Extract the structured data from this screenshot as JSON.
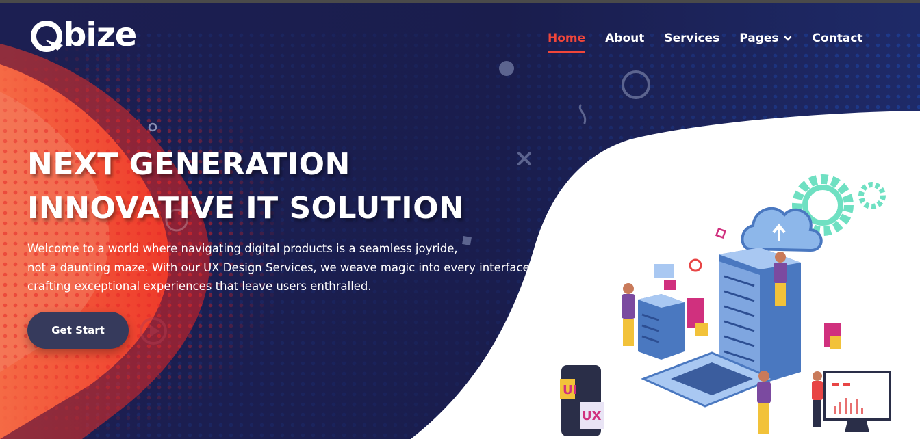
{
  "brand": {
    "name": "bize",
    "accent": "#f0463a",
    "primary": "#1c1f52"
  },
  "nav": {
    "items": [
      {
        "label": "Home",
        "active": true
      },
      {
        "label": "About",
        "active": false
      },
      {
        "label": "Services",
        "active": false
      },
      {
        "label": "Pages",
        "active": false,
        "dropdown": true
      },
      {
        "label": "Contact",
        "active": false
      }
    ]
  },
  "hero": {
    "headline_line1": "NEXT GENERATION",
    "headline_line2": "INNOVATIVE IT SOLUTION",
    "intro_line1": "Welcome to a world where navigating digital products is a seamless joyride,",
    "intro_line2": "not a daunting maze. With our UX Design Services, we weave magic into every interface,",
    "intro_line3": "crafting exceptional experiences that leave users enthralled.",
    "cta_label": "Get Start",
    "play_icon": "play-icon"
  },
  "illustration": {
    "ui_label": "UI",
    "ux_label": "UX",
    "icons": [
      "cloud-upload-icon",
      "gear-icon",
      "server-rack",
      "laptop",
      "phone",
      "monitor-chart"
    ]
  }
}
